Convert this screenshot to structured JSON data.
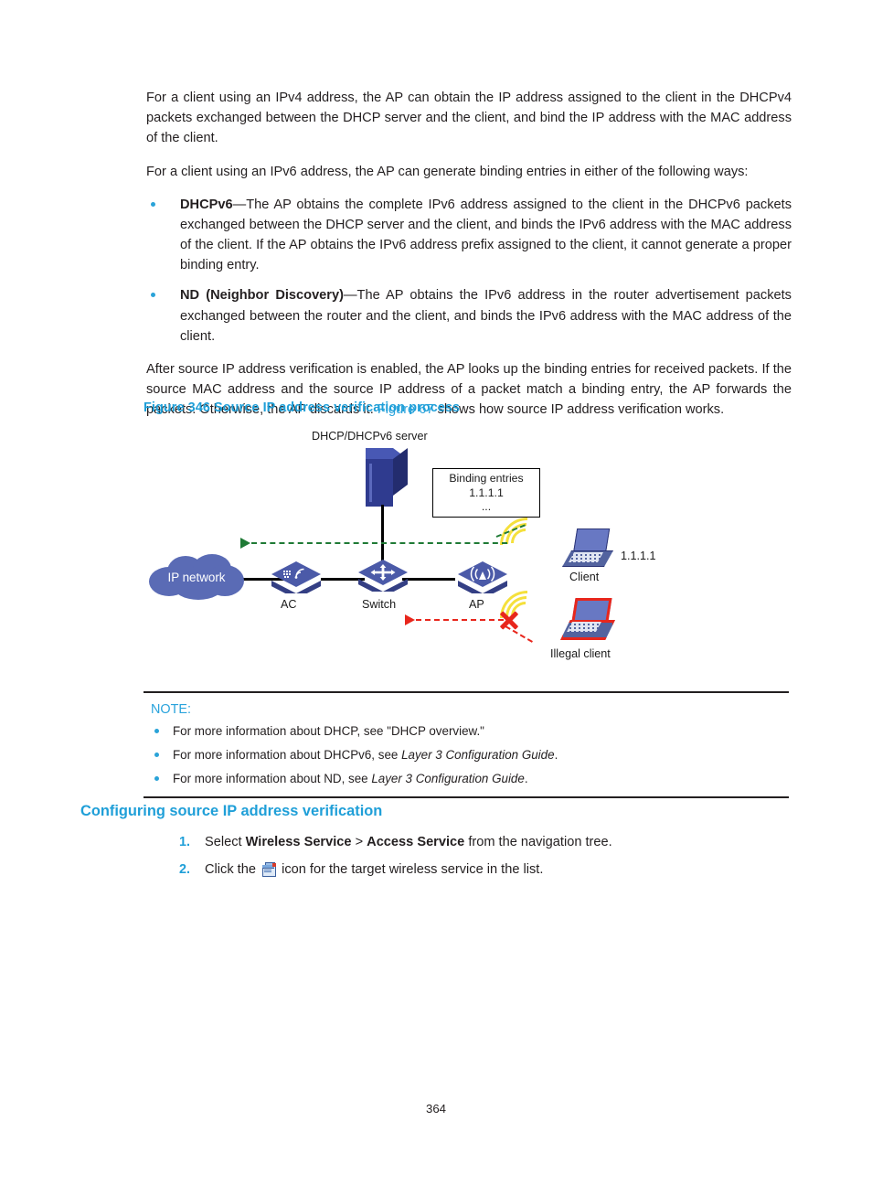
{
  "document": {
    "page_number": "364"
  },
  "paragraphs": {
    "p1": "For a client using an IPv4 address, the AP can obtain the IP address assigned to the client in the DHCPv4 packets exchanged between the DHCP server and the client, and bind the IP address with the MAC address of the client.",
    "p2": "For a client using an IPv6 address, the AP can generate binding entries in either of the following ways:",
    "p3_before_link": "After source IP address verification is enabled, the AP looks up the binding entries for received packets. If the source MAC address and the source IP address of a packet match a binding entry, the AP forwards the packets. Otherwise, the AP discards it. ",
    "p3_link": "Figure 67",
    "p3_after_link": " shows how source IP address verification works."
  },
  "bullets": [
    {
      "term": "DHCPv6",
      "text": "—The AP obtains the complete IPv6 address assigned to the client in the DHCPv6 packets exchanged between the DHCP server and the client, and binds the IPv6 address with the MAC address of the client. If the AP obtains the IPv6 address prefix assigned to the client, it cannot generate a proper binding entry."
    },
    {
      "term": "ND (Neighbor Discovery)",
      "text": "—The AP obtains the IPv6 address in the router advertisement packets exchanged between the router and the client, and binds the IPv6 address with the MAC address of the client."
    }
  ],
  "figure": {
    "caption": "Figure 346 Source IP address verification process",
    "server_label": "DHCP/DHCPv6 server",
    "binding_box": {
      "title": "Binding entries",
      "entry": "1.1.1.1",
      "ellipsis": "..."
    },
    "cloud_label": "IP network",
    "ac_label": "AC",
    "switch_label": "Switch",
    "switch_badge": "SWITCH",
    "ap_label": "AP",
    "client_label": "Client",
    "client_ip": "1.1.1.1",
    "illegal_client_label": "Illegal client",
    "colors": {
      "allowed_flow": "#1f7a35",
      "blocked_flow": "#e8261c",
      "wifi": "#f5e03c",
      "device": "#4b5aa8",
      "cloud": "#5a6bb5",
      "server": "#2f3b8f"
    }
  },
  "note": {
    "title": "NOTE:",
    "items": [
      {
        "text": "For more information about DHCP, see \"DHCP overview.\"",
        "italic": ""
      },
      {
        "text": "For more information about DHCPv6, see ",
        "italic": "Layer 3 Configuration Guide",
        "tail": "."
      },
      {
        "text": "For more information about ND, see ",
        "italic": "Layer 3 Configuration Guide",
        "tail": "."
      }
    ]
  },
  "section": {
    "heading": "Configuring source IP address verification",
    "steps": [
      {
        "number": "1.",
        "before": "Select ",
        "bold1": "Wireless Service",
        "middle": " > ",
        "bold2": "Access Service",
        "after": " from the navigation tree."
      },
      {
        "number": "2.",
        "before": "Click the ",
        "icon": "wireless-service-icon",
        "after": " icon for the target wireless service in the list."
      }
    ]
  }
}
